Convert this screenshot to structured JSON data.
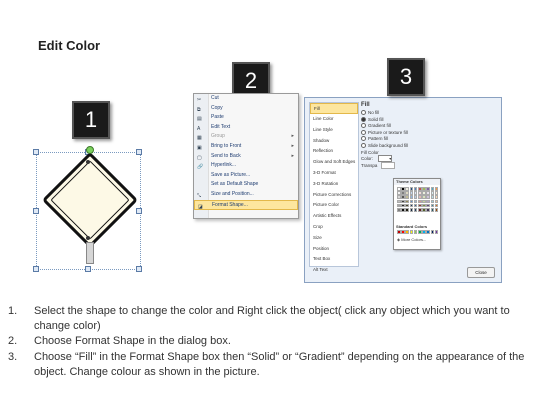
{
  "title": "Edit Color",
  "step_numbers": [
    "1",
    "2",
    "3"
  ],
  "context_menu": {
    "items": [
      {
        "label": "Cut",
        "icon": "scissors-icon",
        "glyph": "✂"
      },
      {
        "label": "Copy",
        "icon": "copy-icon",
        "glyph": "⧉"
      },
      {
        "label": "Paste",
        "icon": "paste-icon",
        "glyph": "▤"
      },
      {
        "label": "Edit Text",
        "icon": "edit-text-icon",
        "glyph": "A"
      },
      {
        "label": "Group",
        "icon": "group-icon",
        "glyph": "▦",
        "submenu": true,
        "disabled": true
      },
      {
        "label": "Bring to Front",
        "icon": "bring-front-icon",
        "glyph": "▣",
        "submenu": true
      },
      {
        "label": "Send to Back",
        "icon": "send-back-icon",
        "glyph": "▢",
        "submenu": true
      },
      {
        "label": "Hyperlink...",
        "icon": "hyperlink-icon",
        "glyph": "🔗"
      },
      {
        "label": "Save as Picture...",
        "icon": "",
        "glyph": ""
      },
      {
        "label": "Set as Default Shape",
        "icon": "",
        "glyph": ""
      },
      {
        "label": "Size and Position...",
        "icon": "size-icon",
        "glyph": "⤡"
      },
      {
        "label": "Format Shape...",
        "icon": "format-shape-icon",
        "glyph": "◪",
        "highlighted": true
      }
    ]
  },
  "dialog": {
    "nav": [
      {
        "label": "Fill",
        "selected": true
      },
      {
        "label": "Line Color"
      },
      {
        "label": "Line Style"
      },
      {
        "label": "Shadow"
      },
      {
        "label": "Reflection"
      },
      {
        "label": "Glow and Soft Edges"
      },
      {
        "label": "3-D Format"
      },
      {
        "label": "3-D Rotation"
      },
      {
        "label": "Picture Corrections"
      },
      {
        "label": "Picture Color"
      },
      {
        "label": "Artistic Effects"
      },
      {
        "label": "Crop"
      },
      {
        "label": "Size"
      },
      {
        "label": "Position"
      },
      {
        "label": "Text Box"
      },
      {
        "label": "Alt Text"
      }
    ],
    "fill_heading": "Fill",
    "fill_options": [
      {
        "label": "No fill",
        "checked": false
      },
      {
        "label": "Solid fill",
        "checked": true
      },
      {
        "label": "Gradient fill",
        "checked": false
      },
      {
        "label": "Picture or texture fill",
        "checked": false
      },
      {
        "label": "Pattern fill",
        "checked": false
      },
      {
        "label": "Slide background fill",
        "checked": false
      }
    ],
    "fill_color_label": "Fill Color",
    "color_label": "Color:",
    "transparency_label": "Transpa",
    "close_label": "Close"
  },
  "palette": {
    "theme_label": "Theme Colors",
    "theme_colors": [
      [
        "#ffffff",
        "#000000",
        "#eeece1",
        "#1f497d",
        "#4f81bd",
        "#c0504d",
        "#9bbb59",
        "#8064a2",
        "#4bacc6",
        "#f79646"
      ],
      [
        "#f2f2f2",
        "#7f7f7f",
        "#ddd9c3",
        "#c6d9f0",
        "#dbe5f1",
        "#f2dcdb",
        "#ebf1dd",
        "#e5e0ec",
        "#dbeef3",
        "#fdeada"
      ],
      [
        "#d8d8d8",
        "#595959",
        "#c4bd97",
        "#8db3e2",
        "#b8cce4",
        "#e5b9b7",
        "#d7e3bc",
        "#ccc1d9",
        "#b7dde8",
        "#fbd5b5"
      ],
      [
        "#bfbfbf",
        "#3f3f3f",
        "#938953",
        "#548dd4",
        "#95b3d7",
        "#d99694",
        "#c3d69b",
        "#b2a2c7",
        "#92cddc",
        "#fac08f"
      ],
      [
        "#a5a5a5",
        "#262626",
        "#494429",
        "#17365d",
        "#366092",
        "#953734",
        "#76923c",
        "#5f497a",
        "#31859b",
        "#e36c09"
      ],
      [
        "#7f7f7f",
        "#0c0c0c",
        "#1d1b10",
        "#0f243e",
        "#244061",
        "#632423",
        "#4f6128",
        "#3f3151",
        "#205867",
        "#974806"
      ]
    ],
    "standard_label": "Standard Colors",
    "standard_colors": [
      "#c00000",
      "#ff0000",
      "#ffc000",
      "#ffff00",
      "#92d050",
      "#00b050",
      "#00b0f0",
      "#0070c0",
      "#002060",
      "#7030a0"
    ],
    "more_label": "More Colors..."
  },
  "instructions": [
    {
      "num": "1.",
      "text": "Select the shape to change the color and Right click the object( click any object which you want to change color)"
    },
    {
      "num": "2.",
      "text": "Choose Format Shape in the dialog box."
    },
    {
      "num": "3.",
      "text": "Choose “Fill” in the Format Shape box then “Solid” or “Gradient” depending on the appearance of the object. Change colour as shown in the picture."
    }
  ],
  "colors": {
    "highlight": "#fde69e",
    "shape_fill": "#fdf9e6",
    "number_box": "#1a1a1a"
  }
}
